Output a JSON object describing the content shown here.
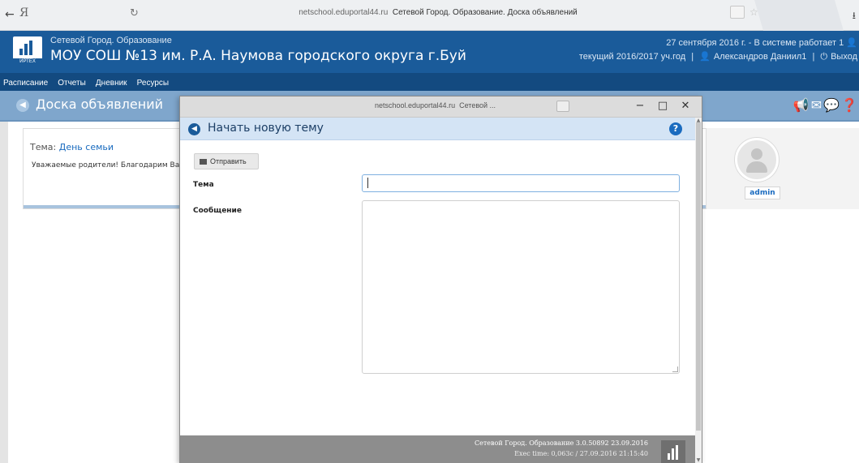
{
  "browser": {
    "back_glyph": "←",
    "ya_glyph": "Я",
    "reload_glyph": "↻",
    "url_host": "netschool.eduportal44.ru",
    "url_title": "Сетевой Город. Образование. Доска объявлений",
    "star_glyph": "☆",
    "download_glyph": "⭳"
  },
  "site": {
    "subtitle": "Сетевой Город. Образование",
    "school": "МОУ СОШ №13 им. Р.А. Наумова городского округа г.Буй",
    "logo_text": "ИРТЕХ",
    "status_line": "27 сентября 2016 г. - В системе работает 1",
    "year_label": "текущий 2016/2017 уч.год",
    "user_name": "Александров Даниил1",
    "logout_label": "Выход"
  },
  "nav": {
    "items": [
      "Расписание",
      "Отчеты",
      "Дневник",
      "Ресурсы"
    ]
  },
  "page": {
    "title": "Доска объявлений",
    "tools": "✉✉💬"
  },
  "topic": {
    "prefix": "Тема:",
    "name": "День семьи",
    "message": "Уважаемые родители! Благодарим Вас"
  },
  "author": {
    "name": "admin"
  },
  "popup": {
    "window_url": "netschool.eduportal44.ru",
    "window_title": "Сетевой ...",
    "minimize": "−",
    "maximize": "□",
    "close": "✕",
    "header_title": "Начать новую тему",
    "help": "?",
    "send_label": "Отправить",
    "subject_label": "Тема",
    "subject_value": "",
    "message_label": "Сообщение",
    "message_value": "",
    "footer_line1": "Сетевой Город. Образование 3.0.50892 23.09.2016",
    "footer_line2": "Exec time: 0,063с / 27.09.2016 21:15:40"
  },
  "colors": {
    "header_blue": "#1a5b9a",
    "nav_blue": "#134a80",
    "title_bar": "#7fa6cc",
    "link": "#1a6bbf"
  }
}
